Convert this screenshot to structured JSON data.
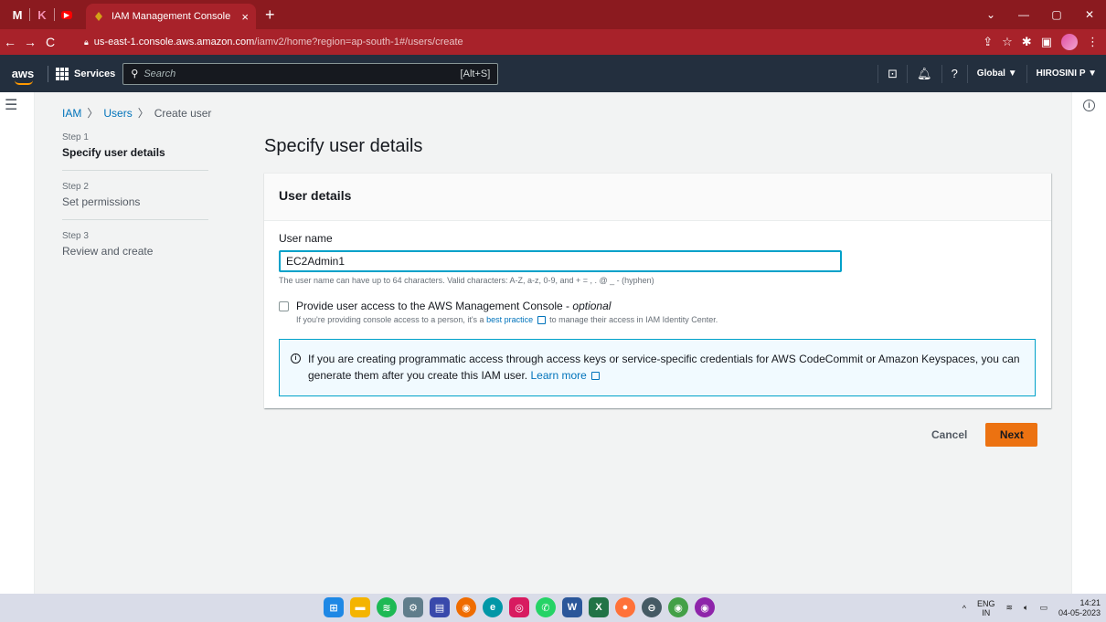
{
  "browser": {
    "tab_title": "IAM Management Console",
    "tab_close": "×",
    "new_tab": "+",
    "pinned_tabs": [
      "M",
      "K",
      "▶"
    ],
    "url_host": "us-east-1.console.aws.amazon.com",
    "url_path": "/iamv2/home?region=ap-south-1#/users/create",
    "window_controls": [
      "⌄",
      "—",
      "▢",
      "✕"
    ]
  },
  "aws_nav": {
    "logo": "aws",
    "services_label": "Services",
    "search_placeholder": "Search",
    "search_shortcut": "[Alt+S]",
    "region_label": "Global ▼",
    "account_label": "HIROSINI P ▼"
  },
  "breadcrumb": {
    "iam": "IAM",
    "users": "Users",
    "current": "Create user"
  },
  "steps": [
    {
      "num": "Step 1",
      "label": "Specify user details"
    },
    {
      "num": "Step 2",
      "label": "Set permissions"
    },
    {
      "num": "Step 3",
      "label": "Review and create"
    }
  ],
  "page_title": "Specify user details",
  "panel": {
    "header": "User details",
    "username_label": "User name",
    "username_value": "EC2Admin1",
    "username_hint": "The user name can have up to 64 characters. Valid characters: A-Z, a-z, 0-9, and + = , . @ _ - (hyphen)",
    "console_access_label": "Provide user access to the AWS Management Console -",
    "console_access_optional": "optional",
    "console_access_desc_prefix": "If you're providing console access to a person, it's a",
    "console_access_desc_link": "best practice",
    "console_access_desc_suffix": "to manage their access in IAM Identity Center.",
    "alert_text": "If you are creating programmatic access through access keys or service-specific credentials for AWS CodeCommit or Amazon Keyspaces, you can generate them after you create this IAM user.",
    "alert_link": "Learn more"
  },
  "actions": {
    "cancel": "Cancel",
    "next": "Next"
  },
  "taskbar": {
    "lang_top": "ENG",
    "lang_bottom": "IN",
    "time": "14:21",
    "date": "04-05-2023"
  },
  "colors": {
    "chrome_tabbar": "#8b1a1f",
    "aws_nav": "#232f3e",
    "primary_button": "#ec7211",
    "link": "#0073bb",
    "focus": "#00a1c9"
  }
}
